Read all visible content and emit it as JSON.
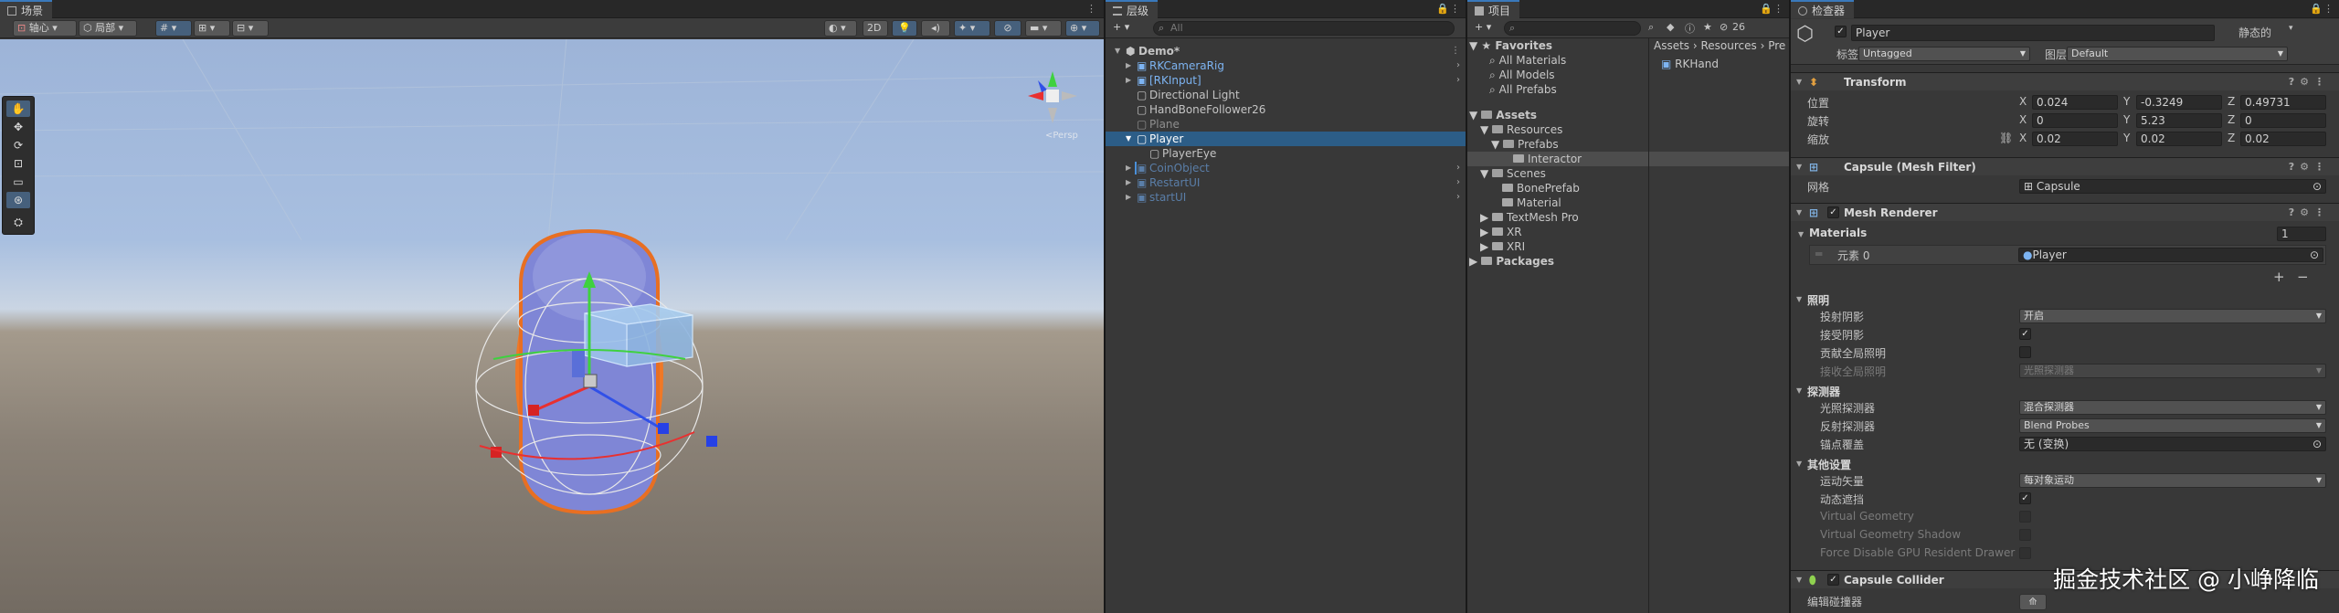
{
  "scene": {
    "tab": "场景",
    "pivot": "轴心",
    "local": "局部",
    "btn_2d": "2D"
  },
  "hierarchy": {
    "tab": "层级",
    "search_placeholder": "All",
    "items": [
      {
        "label": "Demo*"
      },
      {
        "label": "RKCameraRig"
      },
      {
        "label": "[RKInput]"
      },
      {
        "label": "Directional Light"
      },
      {
        "label": "HandBoneFollower26"
      },
      {
        "label": "Plane"
      },
      {
        "label": "Player"
      },
      {
        "label": "PlayerEye"
      },
      {
        "label": "CoinObject"
      },
      {
        "label": "RestartUI"
      },
      {
        "label": "startUI"
      }
    ]
  },
  "project": {
    "tab": "项目",
    "count": "26",
    "favorites": "Favorites",
    "fav_items": [
      "All Materials",
      "All Models",
      "All Prefabs"
    ],
    "assets": "Assets",
    "tree": [
      "Resources",
      "Prefabs",
      "Interactor",
      "Scenes",
      "BonePrefab",
      "Material",
      "TextMesh Pro",
      "XR",
      "XRI",
      "Packages"
    ],
    "breadcrumb": [
      "Assets",
      "Resources",
      "Pre"
    ],
    "files": [
      "RKHand"
    ]
  },
  "inspector": {
    "tab": "检查器",
    "object_name": "Player",
    "static_label": "静态的",
    "tag_label": "标签",
    "tag_value": "Untagged",
    "layer_label": "图层",
    "layer_value": "Default",
    "transform": {
      "title": "Transform",
      "position_label": "位置",
      "rotation_label": "旋转",
      "scale_label": "缩放",
      "position": {
        "x": "0.024",
        "y": "-0.3249",
        "z": "0.49731"
      },
      "rotation": {
        "x": "0",
        "y": "5.23",
        "z": "0"
      },
      "scale": {
        "x": "0.02",
        "y": "0.02",
        "z": "0.02"
      }
    },
    "mesh_filter": {
      "title": "Capsule (Mesh Filter)",
      "mesh_label": "网格",
      "mesh_value": "Capsule"
    },
    "mesh_renderer": {
      "title": "Mesh Renderer",
      "materials_label": "Materials",
      "materials_count": "1",
      "element_label": "元素 0",
      "element_value": "Player",
      "lighting": "照明",
      "cast_shadows_label": "投射阴影",
      "cast_shadows_value": "开启",
      "receive_shadows_label": "接受阴影",
      "contribute_gi_label": "贡献全局照明",
      "receive_gi_label": "接收全局照明",
      "receive_gi_value": "光照探测器",
      "probes": "探测器",
      "light_probes_label": "光照探测器",
      "light_probes_value": "混合探测器",
      "reflection_probes_label": "反射探测器",
      "reflection_probes_value": "Blend Probes",
      "anchor_label": "锚点覆盖",
      "anchor_value": "无 (变换)",
      "additional": "其他设置",
      "motion_vectors_label": "运动矢量",
      "motion_vectors_value": "每对象运动",
      "dynamic_occlusion_label": "动态遮挡",
      "virtual_geometry_label": "Virtual Geometry",
      "virtual_geometry_shadow_label": "Virtual Geometry Shadow",
      "force_disable_label": "Force Disable GPU Resident Drawer"
    },
    "capsule_collider": {
      "title": "Capsule Collider",
      "edit_label": "编辑碰撞器"
    }
  },
  "watermark": "掘金技术社区 @ 小峥降临"
}
